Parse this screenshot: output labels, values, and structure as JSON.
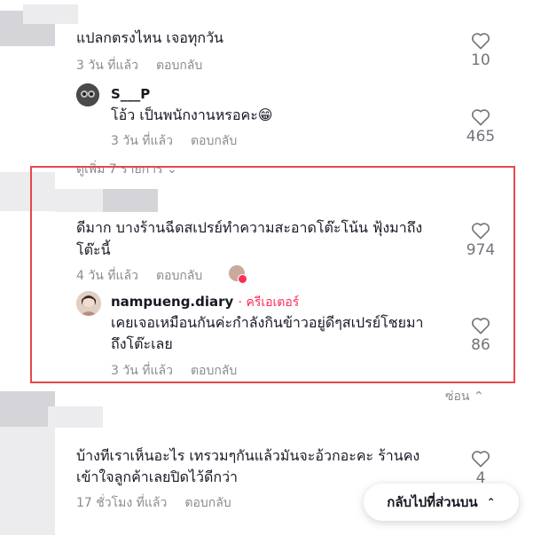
{
  "comments": [
    {
      "text": "แปลกตรงไหน เจอทุกวัน",
      "time": "3 วัน ที่แล้ว",
      "reply_label": "ตอบกลับ",
      "likes": "10",
      "reply": {
        "username": "S___P",
        "text": "โอ้ว เป็นพนักงานหรอคะ😁",
        "time": "3 วัน ที่แล้ว",
        "reply_label": "ตอบกลับ",
        "likes": "465"
      },
      "view_more": "ดูเพิ่ม 7 รายการ"
    },
    {
      "text_line1": "ดีมาก บางร้านฉีดสเปรย์ทำความสะอาดโต๊ะโน้น ฟุ้งมาถึง",
      "text_line2": "โต๊ะนี้",
      "time": "4 วัน ที่แล้ว",
      "reply_label": "ตอบกลับ",
      "likes": "974",
      "reply": {
        "username": "nampueng.diary",
        "creator_tag": "· ครีเอเตอร์",
        "text_line1": "เคยเจอเหมือนกันค่ะกำลังกินข้าวอยู่ดีๆสเปรย์โชยมา",
        "text_line2": "ถึงโต๊ะเลย",
        "time": "3 วัน ที่แล้ว",
        "reply_label": "ตอบกลับ",
        "likes": "86"
      },
      "hide_label": "ซ่อน"
    },
    {
      "text_line1": "บ้างทีเราเห็นอะไร เทรวมๆกันแล้วมันจะอ้วกอะคะ ร้านคง",
      "text_line2": "เข้าใจลูกค้าเลยปิดไว้ดีกว่า",
      "time": "17 ชั่วโมง ที่แล้ว",
      "reply_label": "ตอบกลับ",
      "likes": "4"
    }
  ],
  "back_to_top": "กลับไปที่ส่วนบน",
  "colors": {
    "accent": "#fe2c55",
    "highlight_border": "#e5484d"
  }
}
